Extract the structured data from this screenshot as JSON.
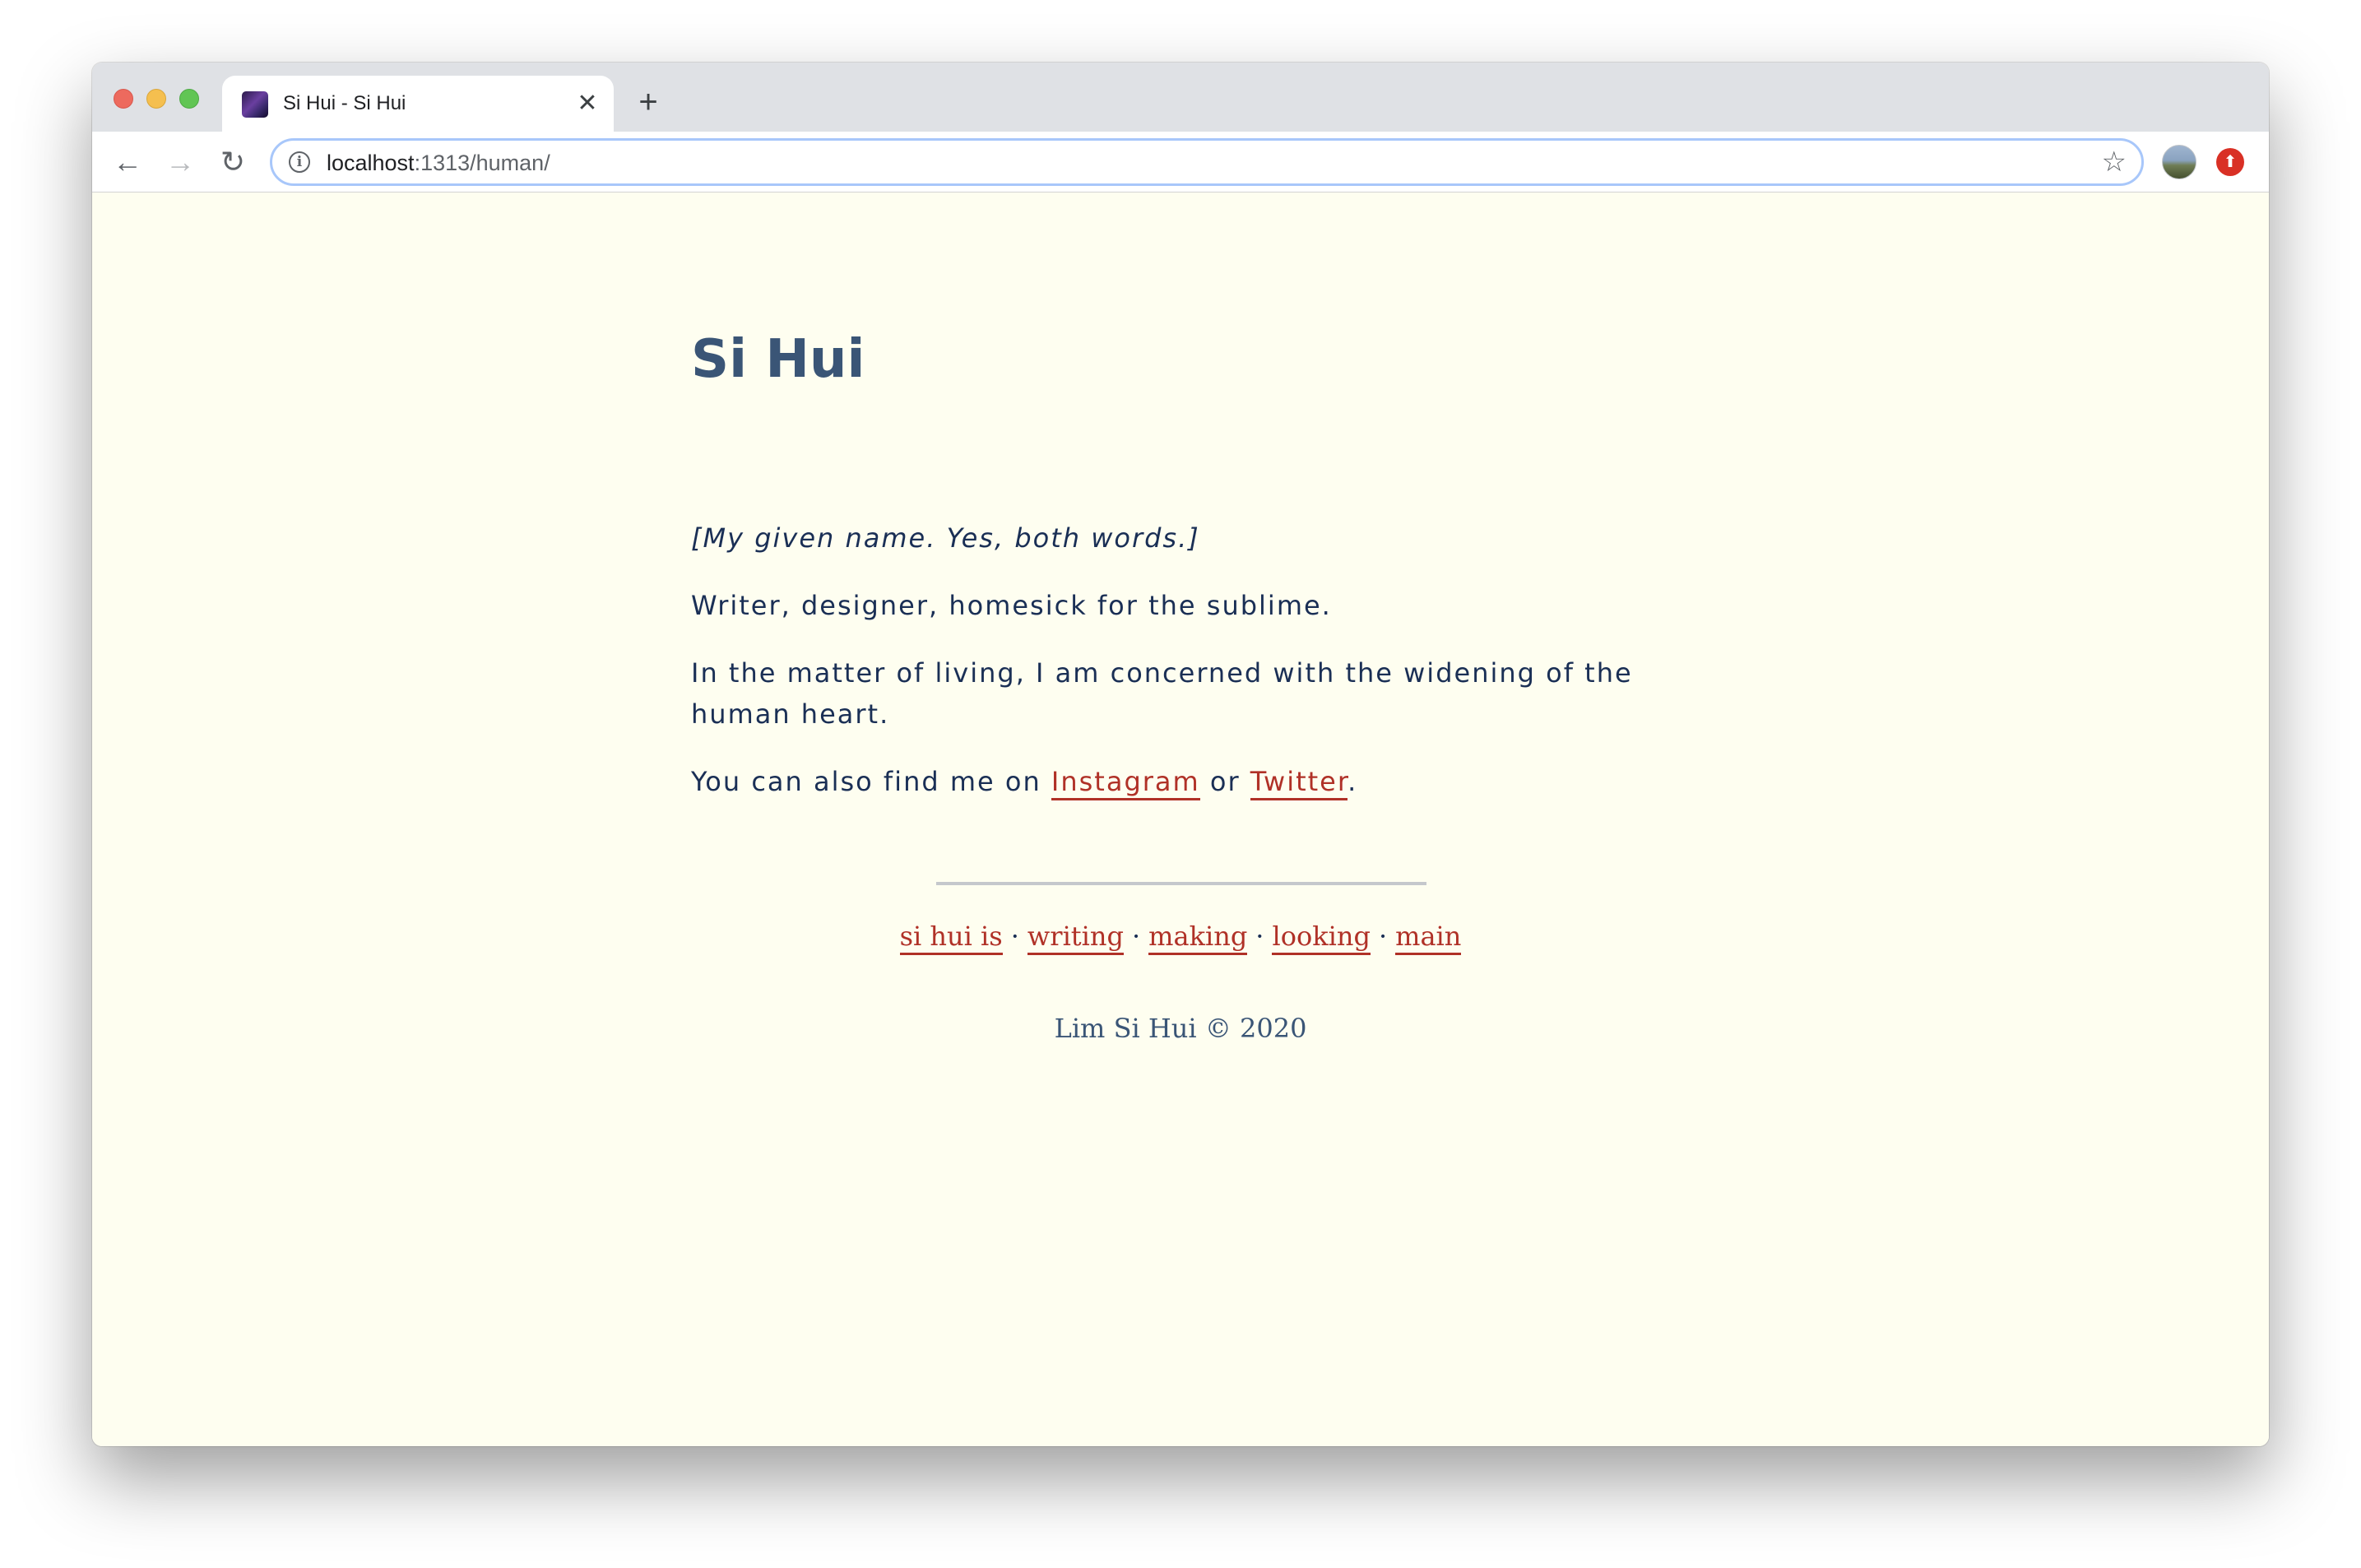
{
  "browser": {
    "tab": {
      "title": "Si Hui - Si Hui",
      "close_icon": "close-icon"
    },
    "new_tab_label": "+",
    "url": {
      "host": "localhost",
      "path": ":1313/human/"
    }
  },
  "page": {
    "title": "Si Hui",
    "intro": "[My given name. Yes, both words.]",
    "role": "Writer, designer, homesick for the sublime.",
    "matter": "In the matter of living, I am concerned with the widening of the human heart.",
    "find_prefix": "You can also find me on ",
    "find_link1": "Instagram",
    "find_mid": " or ",
    "find_link2": "Twitter",
    "find_suffix": ".",
    "nav": [
      "si hui is",
      "writing",
      "making",
      "looking",
      "main"
    ],
    "nav_separator": "·",
    "copyright": "Lim Si Hui © 2020"
  },
  "colors": {
    "page_background": "#fefef0",
    "heading": "#3a5576",
    "body_text": "#1a2f55",
    "link": "#b03127"
  }
}
